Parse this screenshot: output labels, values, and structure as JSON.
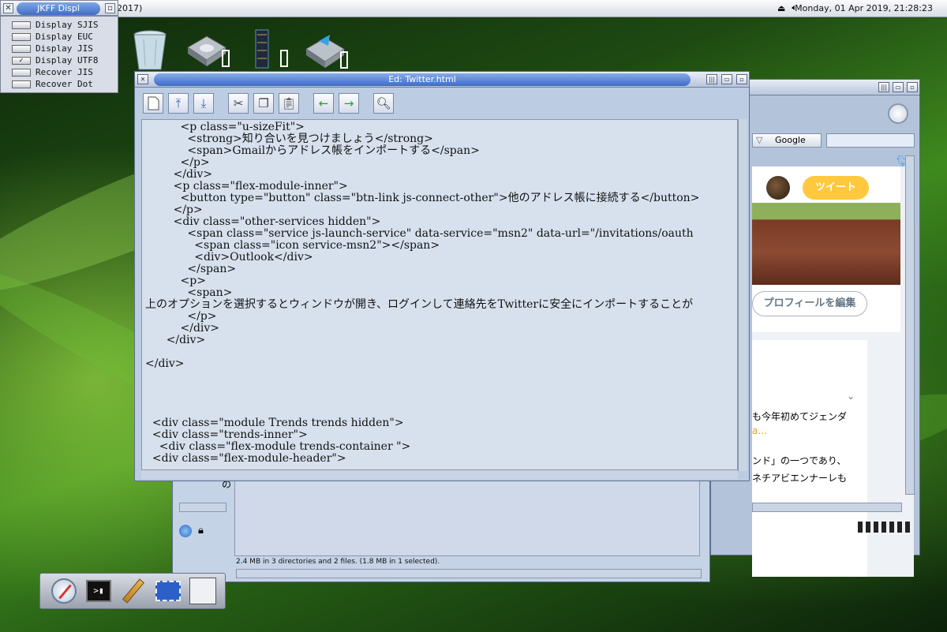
{
  "menubar": {
    "app_title": "2017)",
    "clock": "Monday, 01 Apr 2019, 21:28:23",
    "tray_icons": [
      "eject-icon",
      "speaker-icon"
    ]
  },
  "jkff_menu": {
    "title": "JKFF Displ",
    "items": [
      {
        "label": "Display SJIS",
        "checked": false
      },
      {
        "label": "Display EUC",
        "checked": false
      },
      {
        "label": "Display JIS",
        "checked": false
      },
      {
        "label": "Display UTF8",
        "checked": true
      },
      {
        "label": "Recover JIS",
        "checked": false
      },
      {
        "label": "Recover Dot",
        "checked": false
      }
    ]
  },
  "desktop_icons": [
    "trash-icon",
    "disk-icon",
    "ram-chip-icon",
    "network-disk-icon"
  ],
  "editor": {
    "title": "Ed: Twitter.html",
    "toolbar": [
      "new-file-icon",
      "upload-icon",
      "download-icon",
      "cut-icon",
      "copy-icon",
      "paste-icon",
      "back-arrow-icon",
      "forward-arrow-icon",
      "search-icon"
    ],
    "lines": [
      "          <p class=\"u-sizeFit\">",
      "            <strong>知り合いを見つけましょう</strong>",
      "            <span>Gmailからアドレス帳をインポートする</span>",
      "          </p>",
      "        </div>",
      "        <p class=\"flex-module-inner\">",
      "          <button type=\"button\" class=\"btn-link js-connect-other\">他のアドレス帳に接続する</button>",
      "        </p>",
      "        <div class=\"other-services hidden\">",
      "            <span class=\"service js-launch-service\" data-service=\"msn2\" data-url=\"/invitations/oauth",
      "              <span class=\"icon service-msn2\"></span>",
      "              <div>Outlook</div>",
      "            </span>",
      "          <p>",
      "            <span>",
      "上のオプションを選択するとウィンドウが開き、ログインして連絡先をTwitterに安全にインポートすることが",
      "            </p>",
      "          </div>",
      "      </div>",
      "",
      "</div>",
      "",
      "",
      "",
      "",
      "  <div class=\"module Trends trends hidden\">",
      "  <div class=\"trends-inner\">",
      "    <div class=\"flex-module trends-container \">",
      "  <div class=\"flex-module-header\">"
    ]
  },
  "browser": {
    "search_engine": "Google",
    "tweet_button": "ツイート",
    "edit_profile_button": "プロフィールを編集",
    "text_lines": [
      "も今年初めてジェンダ",
      "a...",
      "ンド」の一つであり、",
      "ネチアビエンナーレも"
    ]
  },
  "filemgr": {
    "status": "2.4 MB in 3 directories and 2 files. (1.8 MB in 1 selected).",
    "left_fragment": "の"
  },
  "dock_icons": [
    "safari-compass-icon",
    "terminal-icon",
    "pencil-icon",
    "screenshot-icon",
    "circuit-icon"
  ],
  "colors": {
    "accent": "#3e6dc6",
    "tweet": "#ffc83d",
    "twitter_blue": "#1da1f2"
  }
}
